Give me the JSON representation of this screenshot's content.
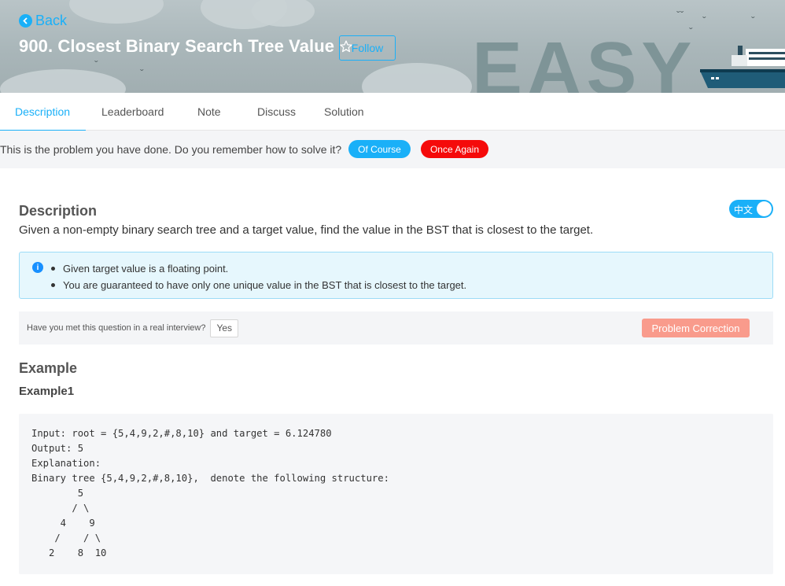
{
  "header": {
    "back_label": "Back",
    "title": "900. Closest Binary Search Tree Value",
    "follow_label": "Follow",
    "difficulty": "EASY"
  },
  "tabs": [
    {
      "label": "Description",
      "active": true
    },
    {
      "label": "Leaderboard",
      "active": false
    },
    {
      "label": "Note",
      "active": false
    },
    {
      "label": "Discuss",
      "active": false
    },
    {
      "label": "Solution",
      "active": false
    }
  ],
  "done_bar": {
    "text": "This is the problem you have done. Do you remember how to solve it?",
    "of_course_label": "Of Course",
    "once_again_label": "Once Again"
  },
  "description": {
    "heading": "Description",
    "language_toggle": "中文",
    "text": "Given a non-empty binary search tree and a target value, find the value in the BST that is closest to the target.",
    "notes": [
      "Given target value is a floating point.",
      "You are guaranteed to have only one unique value in the BST that is closest to the target."
    ]
  },
  "interview": {
    "question": "Have you met this question in a real interview?",
    "yes_label": "Yes",
    "correction_label": "Problem Correction"
  },
  "example": {
    "heading": "Example",
    "sub_heading": "Example1",
    "code": "Input: root = {5,4,9,2,#,8,10} and target = 6.124780\nOutput: 5\nExplanation:\nBinary tree {5,4,9,2,#,8,10},  denote the following structure:\n        5\n       / \\\n     4    9\n    /    / \\\n   2    8  10"
  },
  "colors": {
    "accent": "#1ab0f8",
    "danger": "#f50a0a",
    "correction": "#f99b8c",
    "info_bg": "#e6f7fd"
  }
}
